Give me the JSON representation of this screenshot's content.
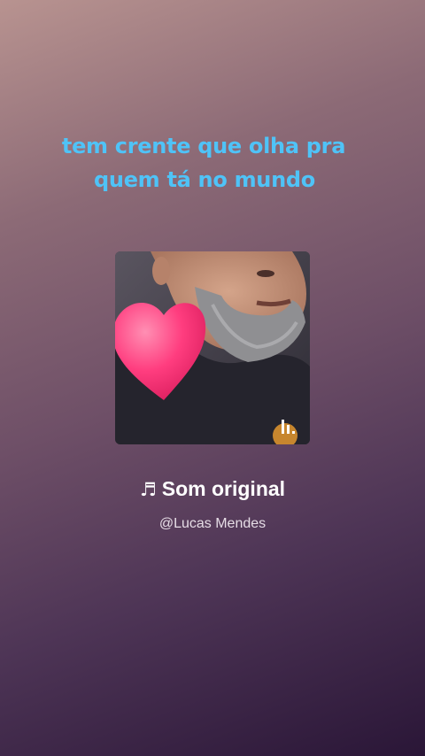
{
  "caption": {
    "line1": "tem crente que olha pra",
    "line2": "quem tá no mundo",
    "color": "#4fc3f7"
  },
  "cover": {
    "alt": "cover image of bearded man with heart sticker",
    "heart_color": "#ff3d7f",
    "equalizer_icon": "equalizer-icon"
  },
  "sound": {
    "note_icon": "music-note-icon",
    "note_glyph": "♬",
    "title": "Som original",
    "author": "@Lucas Mendes"
  }
}
